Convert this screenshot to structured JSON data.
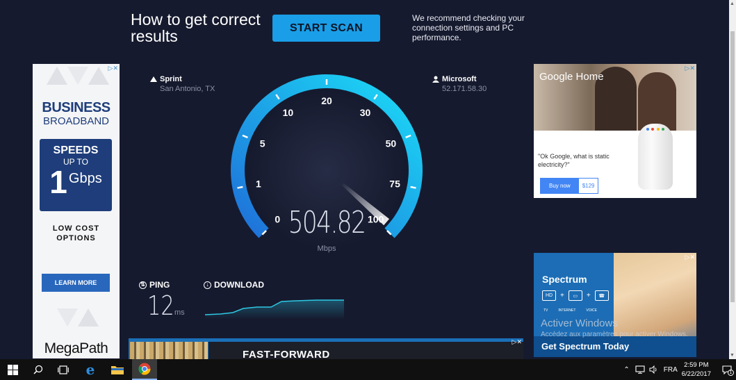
{
  "promo": {
    "title": "How to get correct results",
    "button": "START SCAN",
    "text": "We recommend checking your connection settings and PC performance."
  },
  "ad_left": {
    "adchoice": "▷✕",
    "headline1": "BUSINESS",
    "headline2": "BROADBAND",
    "speeds": "SPEEDS",
    "upto": "UP TO",
    "one": "1",
    "gbps": "Gbps",
    "low_cost": "LOW COST OPTIONS",
    "cta": "LEARN MORE",
    "brand": "MegaPath"
  },
  "servers": {
    "isp_name": "Sprint",
    "isp_location": "San Antonio, TX",
    "host_name": "Microsoft",
    "host_ip": "52.171.58.30"
  },
  "gauge": {
    "ticks": [
      "0",
      "1",
      "5",
      "10",
      "20",
      "30",
      "50",
      "75",
      "100"
    ],
    "speed": "504.82",
    "unit": "Mbps",
    "max": 100,
    "accent_start": "#1e7be0",
    "accent_end": "#19d7f5"
  },
  "stats": {
    "ping_label": "PING",
    "ping_value": "12",
    "ping_unit": "ms",
    "download_label": "DOWNLOAD"
  },
  "banner": {
    "text": "FAST-FORWARD",
    "adchoice": "▷✕"
  },
  "ad_google": {
    "title": "Google Home",
    "quote": "\"Ok Google, what is static electricity?\"",
    "buy": "Buy now",
    "price": "$129",
    "adchoice": "▷✕"
  },
  "ad_spectrum": {
    "logo": "Spectrum",
    "icons": [
      "HD",
      "▭",
      "☎"
    ],
    "captions": [
      "TV",
      "INTERNET",
      "VOICE"
    ],
    "cta": "Get Spectrum Today",
    "adchoice": "▷✕"
  },
  "watermark": {
    "line1": "Activer Windows",
    "line2": "Accédez aux paramètres pour activer Windows."
  },
  "taskbar": {
    "language": "FRA",
    "time": "2:59 PM",
    "date": "6/22/2017",
    "notification_count": "1"
  }
}
